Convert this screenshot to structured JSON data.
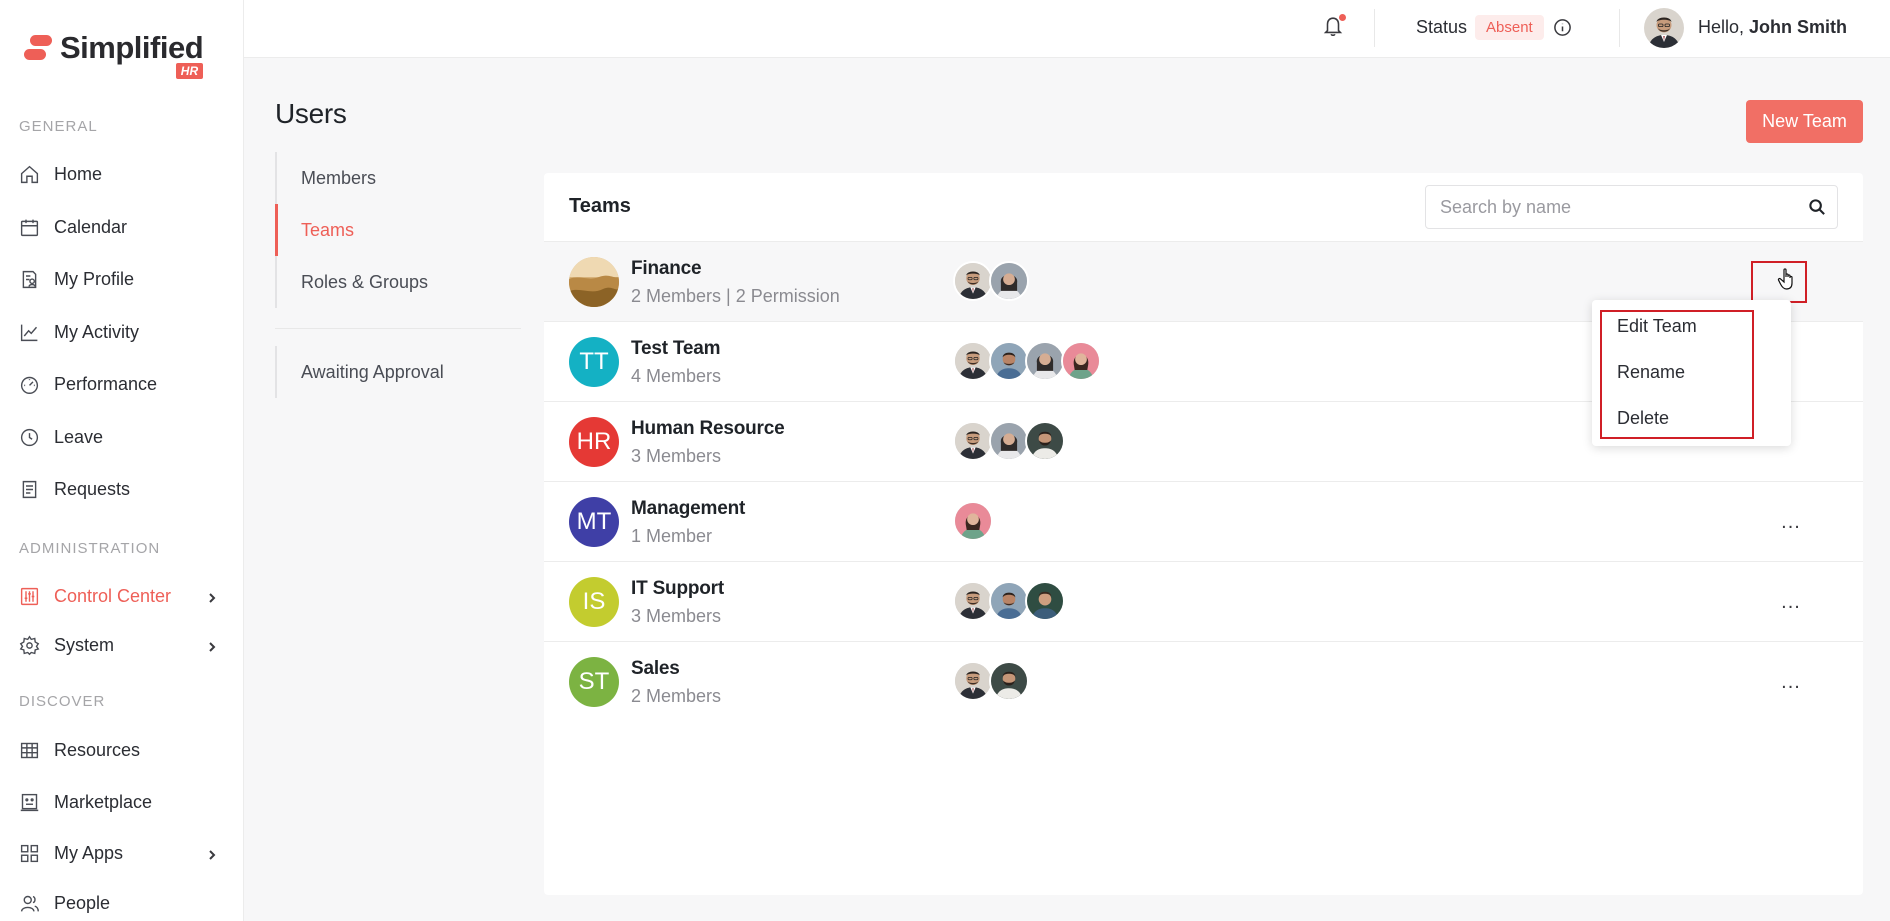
{
  "brand": {
    "name": "Simplified",
    "tag": "HR",
    "accent": "#ee5f57"
  },
  "sidebar": {
    "sections": [
      "GENERAL",
      "ADMINISTRATION",
      "DISCOVER"
    ],
    "general": [
      {
        "label": "Home",
        "icon": "home-icon"
      },
      {
        "label": "Calendar",
        "icon": "calendar-icon"
      },
      {
        "label": "My Profile",
        "icon": "profile-icon"
      },
      {
        "label": "My Activity",
        "icon": "activity-icon"
      },
      {
        "label": "Performance",
        "icon": "gauge-icon"
      },
      {
        "label": "Leave",
        "icon": "clock-icon"
      },
      {
        "label": "Requests",
        "icon": "requests-icon"
      }
    ],
    "administration": [
      {
        "label": "Control Center",
        "icon": "sliders-icon",
        "active": true
      },
      {
        "label": "System",
        "icon": "gear-icon"
      }
    ],
    "discover": [
      {
        "label": "Resources",
        "icon": "table-icon"
      },
      {
        "label": "Marketplace",
        "icon": "marketplace-icon"
      },
      {
        "label": "My Apps",
        "icon": "grid-icon"
      },
      {
        "label": "People",
        "icon": "people-icon"
      }
    ]
  },
  "header": {
    "status_label": "Status",
    "status_value": "Absent",
    "hello_prefix": "Hello,",
    "user_name": "John Smith"
  },
  "page": {
    "title": "Users",
    "new_team_label": "New Team",
    "subnav": [
      "Members",
      "Teams",
      "Roles & Groups",
      "Awaiting Approval"
    ],
    "subnav_active": "Teams"
  },
  "teams": {
    "title": "Teams",
    "search_placeholder": "Search by name",
    "rows": [
      {
        "initials": "",
        "name": "Finance",
        "meta": "2 Members | 2 Permission",
        "color": "#c9a66b"
      },
      {
        "initials": "TT",
        "name": "Test Team",
        "meta": "4 Members",
        "color": "#14b1c4"
      },
      {
        "initials": "HR",
        "name": "Human Resource",
        "meta": "3 Members",
        "color": "#e53935"
      },
      {
        "initials": "MT",
        "name": "Management",
        "meta": "1 Member",
        "color": "#3f3fa6"
      },
      {
        "initials": "IS",
        "name": "IT Support",
        "meta": "3 Members",
        "color": "#c3cc2f"
      },
      {
        "initials": "ST",
        "name": "Sales",
        "meta": "2 Members",
        "color": "#7cb342"
      }
    ],
    "more_label": "..."
  },
  "menu": {
    "items": [
      "Edit Team",
      "Rename",
      "Delete"
    ]
  }
}
